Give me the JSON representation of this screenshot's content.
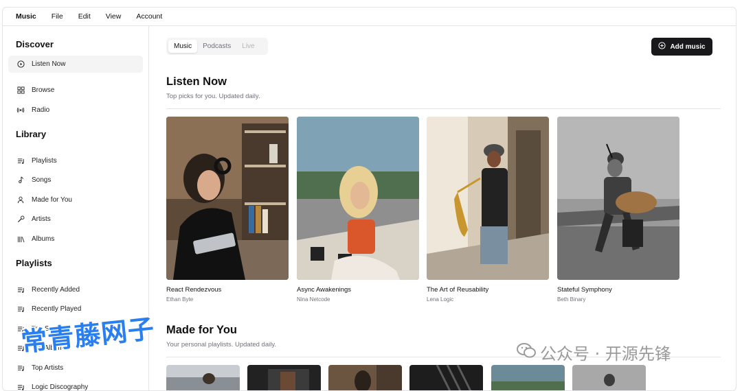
{
  "menubar": {
    "items": [
      "Music",
      "File",
      "Edit",
      "View",
      "Account"
    ]
  },
  "sidebar": {
    "discover": {
      "title": "Discover",
      "items": [
        {
          "label": "Listen Now",
          "icon": "play-circle-icon"
        },
        {
          "label": "Browse",
          "icon": "grid-icon"
        },
        {
          "label": "Radio",
          "icon": "radio-icon"
        }
      ]
    },
    "library": {
      "title": "Library",
      "items": [
        {
          "label": "Playlists",
          "icon": "playlist-icon"
        },
        {
          "label": "Songs",
          "icon": "music-note-icon"
        },
        {
          "label": "Made for You",
          "icon": "user-icon"
        },
        {
          "label": "Artists",
          "icon": "microphone-icon"
        },
        {
          "label": "Albums",
          "icon": "library-icon"
        }
      ]
    },
    "playlists": {
      "title": "Playlists",
      "items": [
        {
          "label": "Recently Added",
          "icon": "playlist-icon"
        },
        {
          "label": "Recently Played",
          "icon": "playlist-icon"
        },
        {
          "label": "Top Songs",
          "icon": "playlist-icon"
        },
        {
          "label": "Top Albums",
          "icon": "playlist-icon"
        },
        {
          "label": "Top Artists",
          "icon": "playlist-icon"
        },
        {
          "label": "Logic Discography",
          "icon": "playlist-icon"
        }
      ]
    }
  },
  "tabs": [
    "Music",
    "Podcasts",
    "Live"
  ],
  "add_button": {
    "label": "Add music",
    "icon": "plus-circle-icon"
  },
  "listen_now": {
    "title": "Listen Now",
    "subtitle": "Top picks for you. Updated daily.",
    "albums": [
      {
        "title": "React Rendezvous",
        "artist": "Ethan Byte"
      },
      {
        "title": "Async Awakenings",
        "artist": "Nina Netcode"
      },
      {
        "title": "The Art of Reusability",
        "artist": "Lena Logic"
      },
      {
        "title": "Stateful Symphony",
        "artist": "Beth Binary"
      }
    ]
  },
  "made_for_you": {
    "title": "Made for You",
    "subtitle": "Your personal playlists. Updated daily."
  },
  "watermarks": {
    "left": "常青藤网子",
    "right": "公众号 · 开源先锋"
  },
  "colors": {
    "accent": "#18181b",
    "muted": "#71717a",
    "border": "#e4e4e7",
    "watermark": "#2a7ff0"
  }
}
